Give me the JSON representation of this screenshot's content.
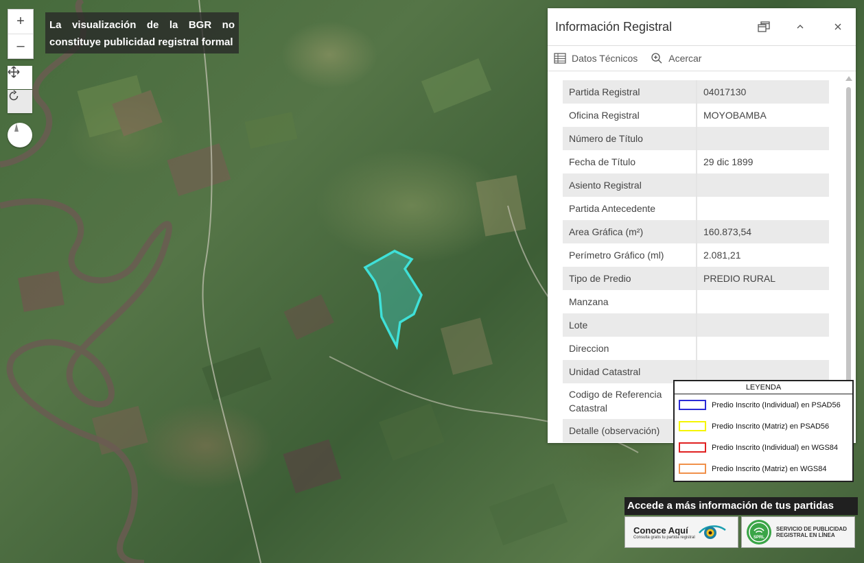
{
  "map": {
    "disclaimer_line1": "La visualización de la BGR no",
    "disclaimer_line2": "constituye publicidad registral formal",
    "zoom_in": "+",
    "zoom_out": "–"
  },
  "panel": {
    "title": "Información Registral",
    "toolbar": {
      "tech_data": "Datos Técnicos",
      "zoom_to": "Acercar"
    },
    "rows": [
      {
        "key": "Partida Registral",
        "value": "04017130"
      },
      {
        "key": "Oficina Registral",
        "value": "MOYOBAMBA"
      },
      {
        "key": "Número de Título",
        "value": ""
      },
      {
        "key": "Fecha de Título",
        "value": "29 dic 1899"
      },
      {
        "key": "Asiento Registral",
        "value": ""
      },
      {
        "key": "Partida Antecedente",
        "value": ""
      },
      {
        "key": "Area Gráfica (m²)",
        "value": "160.873,54"
      },
      {
        "key": "Perímetro Gráfico (ml)",
        "value": "2.081,21"
      },
      {
        "key": "Tipo de Predio",
        "value": "PREDIO RURAL"
      },
      {
        "key": "Manzana",
        "value": ""
      },
      {
        "key": "Lote",
        "value": ""
      },
      {
        "key": "Direccion",
        "value": ""
      },
      {
        "key": "Unidad Catastral",
        "value": ""
      },
      {
        "key": "Codigo de Referencia Catastral",
        "value": ""
      },
      {
        "key": "Detalle (observación)",
        "value": ""
      }
    ]
  },
  "legend": {
    "title": "LEYENDA",
    "items": [
      {
        "label": "Predio Inscrito (Individual) en PSAD56",
        "color": "#2b2bd6"
      },
      {
        "label": "Predio Inscrito (Matriz) en PSAD56",
        "color": "#f5f500"
      },
      {
        "label": "Predio Inscrito (Individual) en WGS84",
        "color": "#e02020"
      },
      {
        "label": "Predio Inscrito (Matriz) en WGS84",
        "color": "#f0904a"
      }
    ]
  },
  "banner": {
    "title": "Accede a más información de tus partidas",
    "conoce_title": "Conoce Aquí",
    "conoce_sub": "Consulta gratis tu partida registral",
    "sprl_line1": "SERVICIO DE PUBLICIDAD",
    "sprl_line2": "REGISTRAL EN LÍNEA",
    "sprl_badge": "SPRL"
  },
  "colors": {
    "parcel": "#3fe0d8"
  }
}
